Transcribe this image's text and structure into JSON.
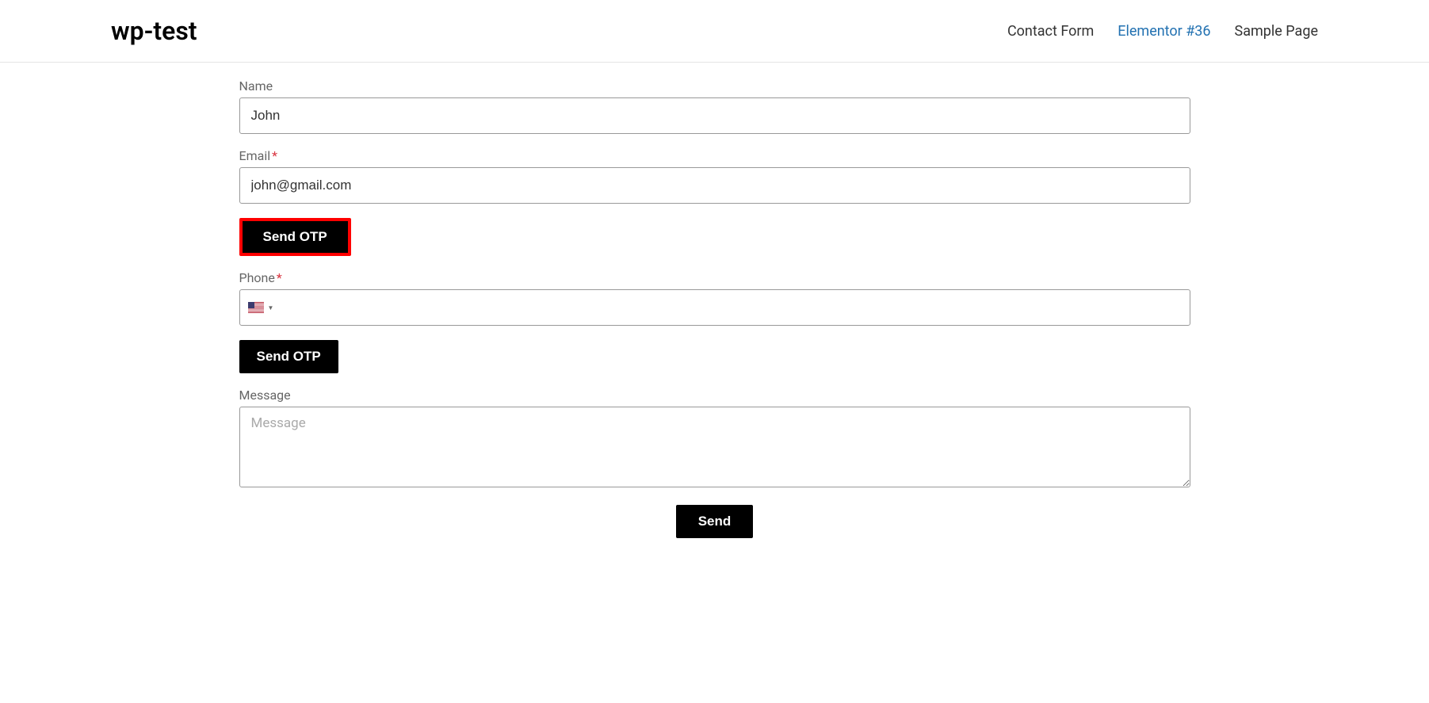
{
  "header": {
    "site_title": "wp-test",
    "nav": [
      {
        "label": "Contact Form",
        "active": false
      },
      {
        "label": "Elementor #36",
        "active": true
      },
      {
        "label": "Sample Page",
        "active": false
      }
    ]
  },
  "form": {
    "name": {
      "label": "Name",
      "value": "John",
      "required": false
    },
    "email": {
      "label": "Email",
      "value": "john@gmail.com",
      "required": true,
      "required_mark": "*"
    },
    "send_otp_email": {
      "label": "Send OTP"
    },
    "phone": {
      "label": "Phone",
      "value": "",
      "required": true,
      "required_mark": "*",
      "country": "us"
    },
    "send_otp_phone": {
      "label": "Send OTP"
    },
    "message": {
      "label": "Message",
      "placeholder": "Message",
      "value": ""
    },
    "submit": {
      "label": "Send"
    }
  }
}
